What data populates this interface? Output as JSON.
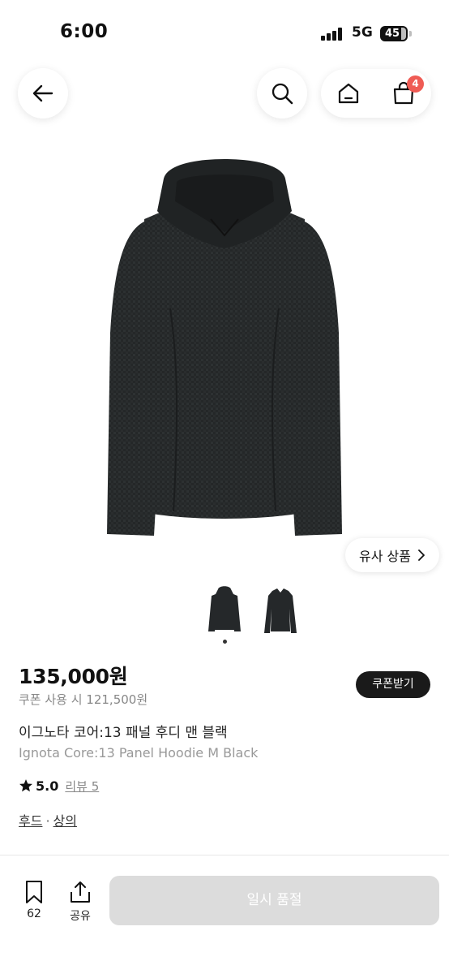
{
  "status_bar": {
    "time": "6:00",
    "network": "5G",
    "battery": "45"
  },
  "header": {
    "cart_count": "4"
  },
  "icons": {
    "back": "arrow-left-icon",
    "search": "search-icon",
    "home": "home-icon",
    "cart": "shopping-bag-icon",
    "star": "star-icon",
    "chevron": "chevron-right-icon",
    "bookmark": "bookmark-icon",
    "share": "share-icon"
  },
  "gallery": {
    "similar_label": "유사 상품",
    "thumbnail_count": 2,
    "active_index": 0
  },
  "product": {
    "price": "135,000원",
    "coupon_price": "쿠폰 사용 시 121,500원",
    "coupon_button": "쿠폰받기",
    "name_ko": "이그노타 코어:13 패널 후디 맨 블랙",
    "name_en": "Ignota Core:13 Panel Hoodie M Black",
    "rating": "5.0",
    "review_label": "리뷰 5",
    "categories": [
      "후드",
      "상의"
    ],
    "category_separator": "·"
  },
  "bottom_bar": {
    "bookmark_count": "62",
    "share_label": "공유",
    "sold_out_label": "일시 품절"
  },
  "colors": {
    "badge": "#ef5b54",
    "primary_dark": "#1a1a1a",
    "disabled": "#dcdcdc"
  }
}
